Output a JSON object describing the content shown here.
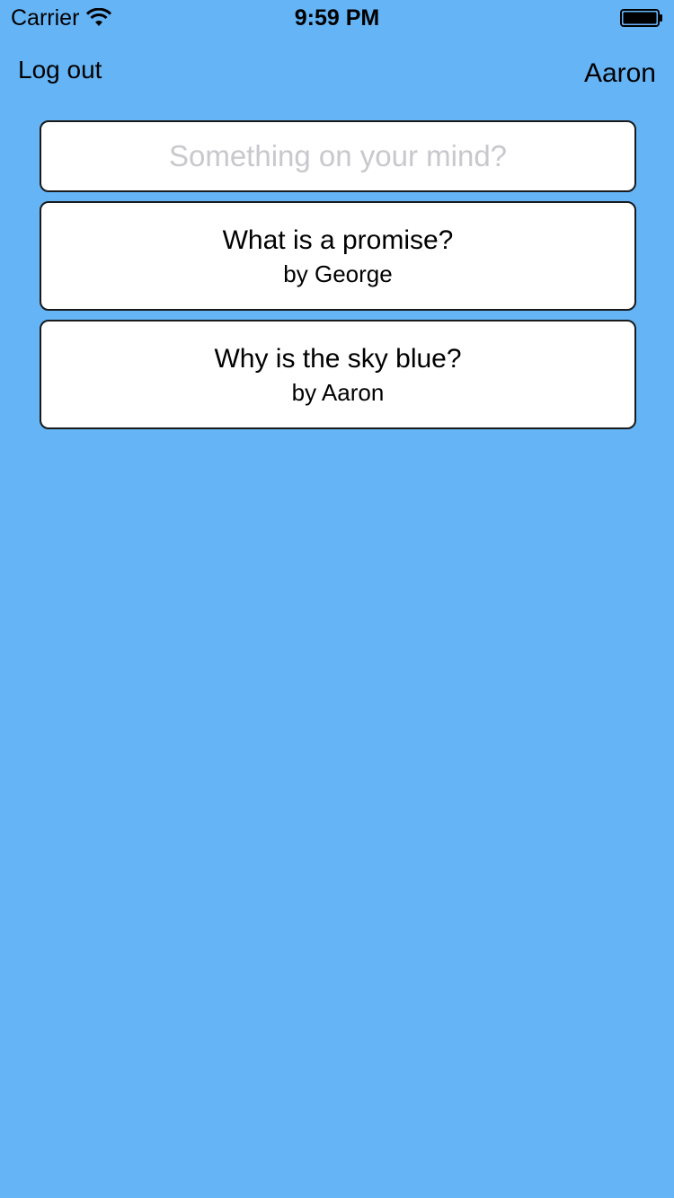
{
  "status_bar": {
    "carrier": "Carrier",
    "time": "9:59 PM",
    "wifi_icon": "wifi-icon",
    "battery_icon": "battery-icon"
  },
  "header": {
    "logout_label": "Log out",
    "username": "Aaron"
  },
  "composer": {
    "placeholder": "Something on your mind?",
    "value": ""
  },
  "questions": [
    {
      "title": "What is a promise?",
      "author": "by George"
    },
    {
      "title": "Why is the sky blue?",
      "author": "by Aaron"
    }
  ],
  "colors": {
    "background": "#64b4f6",
    "card": "#ffffff",
    "border": "#1a1a1a",
    "placeholder": "#c8c8cd"
  }
}
